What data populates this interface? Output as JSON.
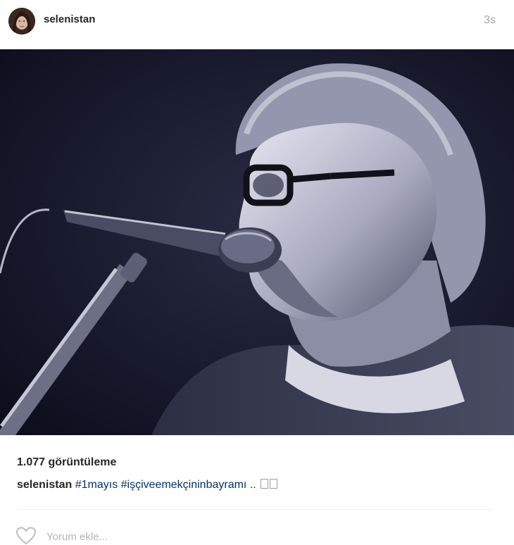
{
  "post": {
    "username": "selenistan",
    "timestamp": "3s",
    "views_text": "1.077 görüntüleme",
    "caption": {
      "user": "selenistan",
      "hashtags": [
        "#1mayıs",
        "#işçiveemekçininbayramı"
      ],
      "trailing": " .."
    },
    "comment_placeholder": "Yorum ekle...",
    "media": {
      "alt": "Black and white photo of a singer with glasses at a microphone"
    }
  },
  "colors": {
    "text": "#262626",
    "muted": "#a8a8a8",
    "hashtag": "#003569",
    "media_bg": "#141629"
  }
}
